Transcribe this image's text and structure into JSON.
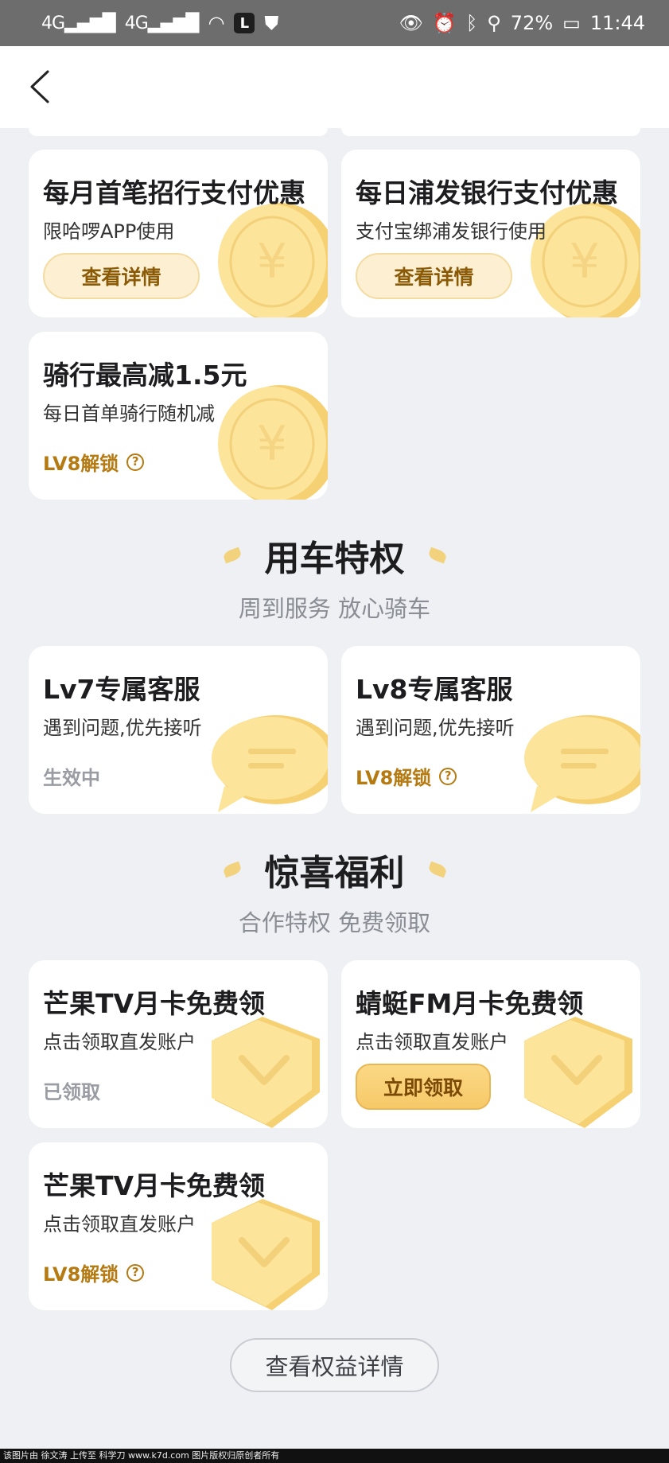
{
  "status_bar": {
    "signal1": "4G",
    "signal2": "4G",
    "app_badge": "L",
    "battery": "72%",
    "time": "11:44"
  },
  "cards_top": [
    {
      "title": "每月首笔招行支付优惠",
      "subtitle": "限哈啰APP使用",
      "action": "查看详情"
    },
    {
      "title": "每日浦发银行支付优惠",
      "subtitle": "支付宝绑浦发银行使用",
      "action": "查看详情"
    },
    {
      "title": "骑行最高减1.5元",
      "subtitle": "每日首单骑行随机减",
      "lock": "LV8解锁"
    }
  ],
  "section_car": {
    "title": "用车特权",
    "subtitle": "周到服务 放心骑车",
    "cards": [
      {
        "title": "Lv7专属客服",
        "subtitle": "遇到问题,优先接听",
        "status": "生效中"
      },
      {
        "title": "Lv8专属客服",
        "subtitle": "遇到问题,优先接听",
        "lock": "LV8解锁"
      }
    ]
  },
  "section_gift": {
    "title": "惊喜福利",
    "subtitle": "合作特权 免费领取",
    "cards": [
      {
        "title": "芒果TV月卡免费领",
        "subtitle": "点击领取直发账户",
        "status": "已领取"
      },
      {
        "title": "蜻蜓FM月卡免费领",
        "subtitle": "点击领取直发账户",
        "action": "立即领取"
      },
      {
        "title": "芒果TV月卡免费领",
        "subtitle": "点击领取直发账户",
        "lock": "LV8解锁"
      }
    ]
  },
  "detail_button": "查看权益详情",
  "footer_text": "该图片由 徐文涛 上传至 科学刀 www.k7d.com 图片版权归原创者所有",
  "colors": {
    "accent": "#b57a11",
    "background": "#eef0f4",
    "coin": "#fbdc8a"
  },
  "icons": [
    "back-arrow-icon",
    "coin-icon",
    "chat-bubble-icon",
    "shield-icon",
    "question-icon"
  ]
}
